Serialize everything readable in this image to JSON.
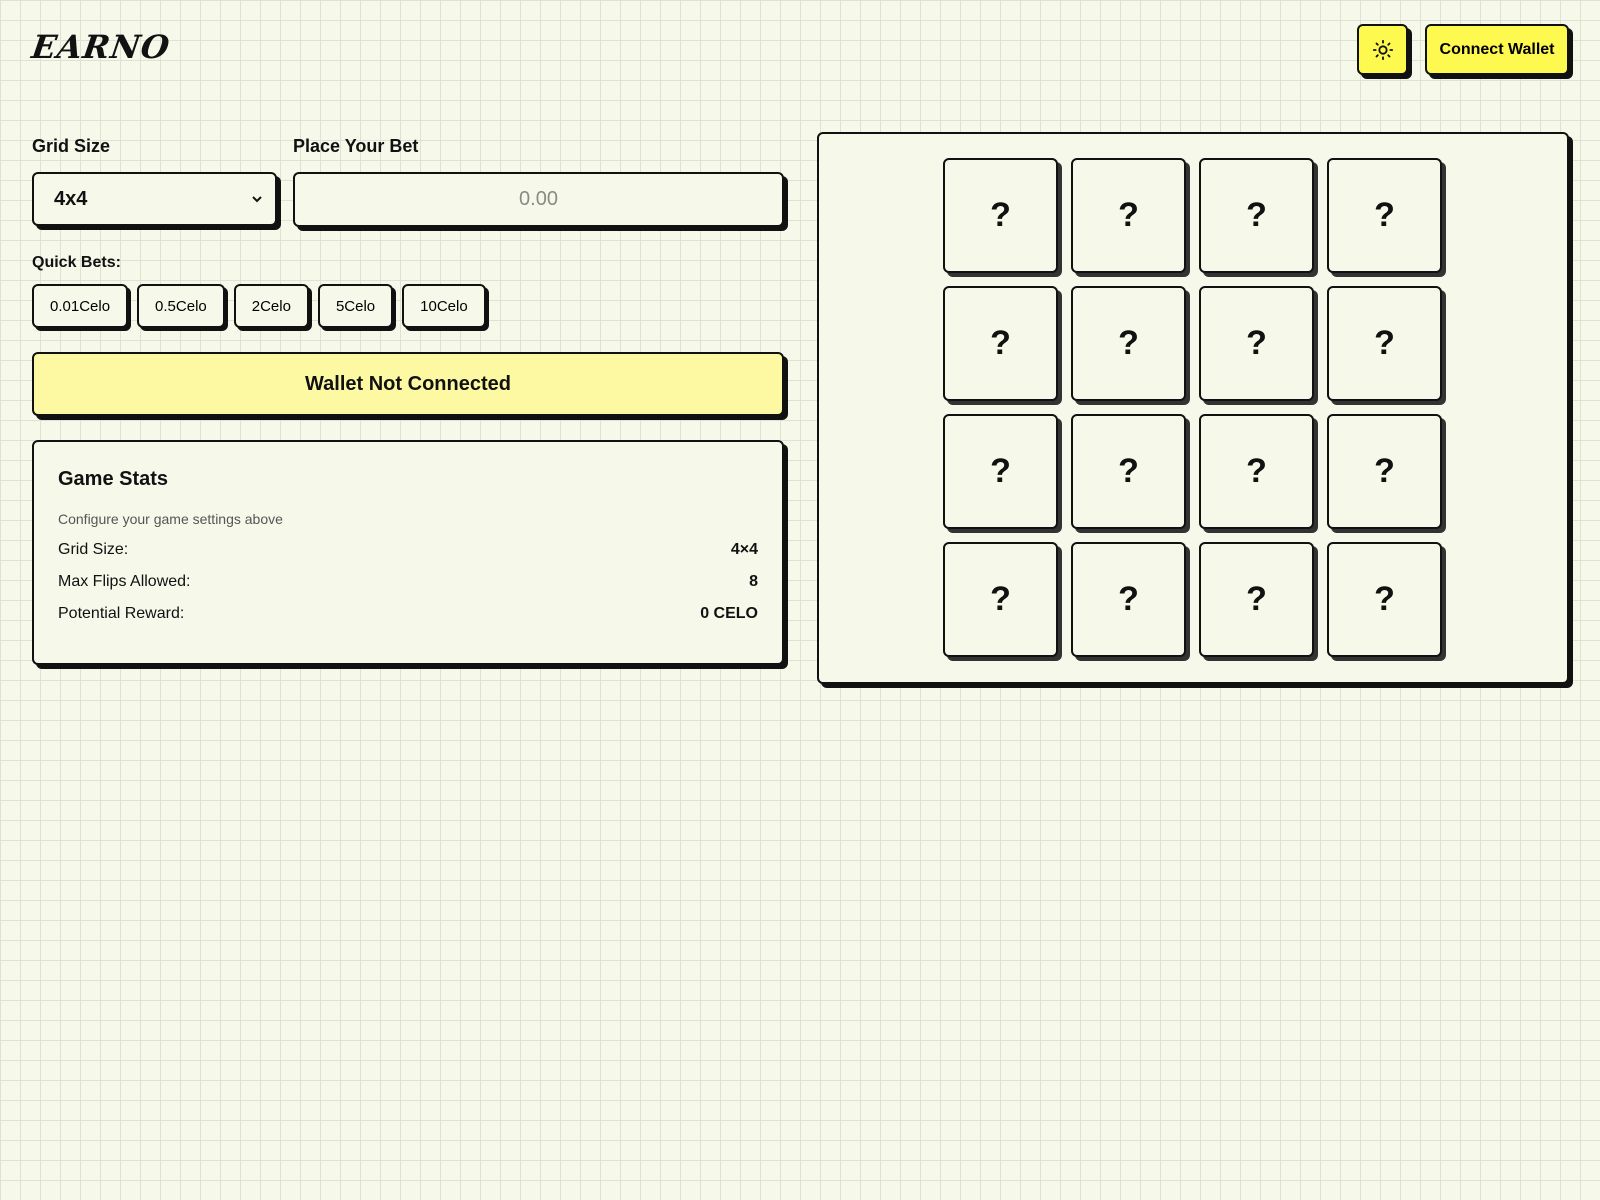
{
  "header": {
    "logo_text": "EARNO",
    "theme_icon": "sun-icon",
    "connect_label": "Connect Wallet"
  },
  "controls": {
    "grid_size_label": "Grid Size",
    "grid_size_value": "4x4",
    "bet_label": "Place Your Bet",
    "bet_placeholder": "0.00",
    "quick_bets_label": "Quick Bets:",
    "quick_bets": [
      "0.01Celo",
      "0.5Celo",
      "2Celo",
      "5Celo",
      "10Celo"
    ],
    "wallet_status": "Wallet Not Connected"
  },
  "stats": {
    "title": "Game Stats",
    "subtitle": "Configure your game settings above",
    "rows": [
      {
        "label": "Grid Size:",
        "value": "4×4"
      },
      {
        "label": "Max Flips Allowed:",
        "value": "8"
      },
      {
        "label": "Potential Reward:",
        "value": "0 CELO"
      }
    ]
  },
  "board": {
    "tiles": [
      "?",
      "?",
      "?",
      "?",
      "?",
      "?",
      "?",
      "?",
      "?",
      "?",
      "?",
      "?",
      "?",
      "?",
      "?",
      "?"
    ]
  }
}
